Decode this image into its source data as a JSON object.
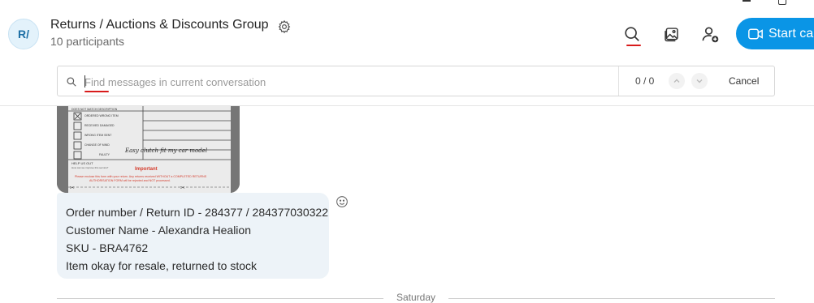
{
  "conversation": {
    "avatar_initials": "R/",
    "title": "Returns / Auctions & Discounts Group",
    "participants": "10 participants"
  },
  "header_actions": {
    "start_call_label": "Start call",
    "icons": [
      "search-icon",
      "gallery-icon",
      "add-person-icon",
      "video-icon",
      "settings-gear-icon"
    ]
  },
  "find_bar": {
    "placeholder": "Find messages in current conversation",
    "value": "",
    "count": "0 / 0",
    "cancel_label": "Cancel"
  },
  "message": {
    "image_form": {
      "options": [
        "DOES NOT MATCH DESCRIPTION",
        "ORDERED WRONG ITEM",
        "RECEIVED DAMAGED",
        "WRONG ITEM SENT",
        "CHANGE OF MIND",
        "FAULTY"
      ],
      "handwritten_reason": "Easy clutch fit my car model",
      "help_label": "HELP US OUT",
      "help_sub": "How can we improve this service?",
      "important_label": "Important",
      "important_text": "Please enclose this form with your return. Any returns received WITHOUT a COMPLETED RETURNS AUTHORISATION FORM will be rejected and NOT processed."
    },
    "lines": [
      "Order number / Return ID - 284377 / 284377030322",
      "Customer Name - Alexandra Healion",
      "SKU - BRA4762",
      "Item okay for resale, returned to stock"
    ]
  },
  "day_separator": "Saturday",
  "colors": {
    "accent": "#0a95e6",
    "bubble": "#edf3f8",
    "annotation_red": "#d81b1b"
  }
}
